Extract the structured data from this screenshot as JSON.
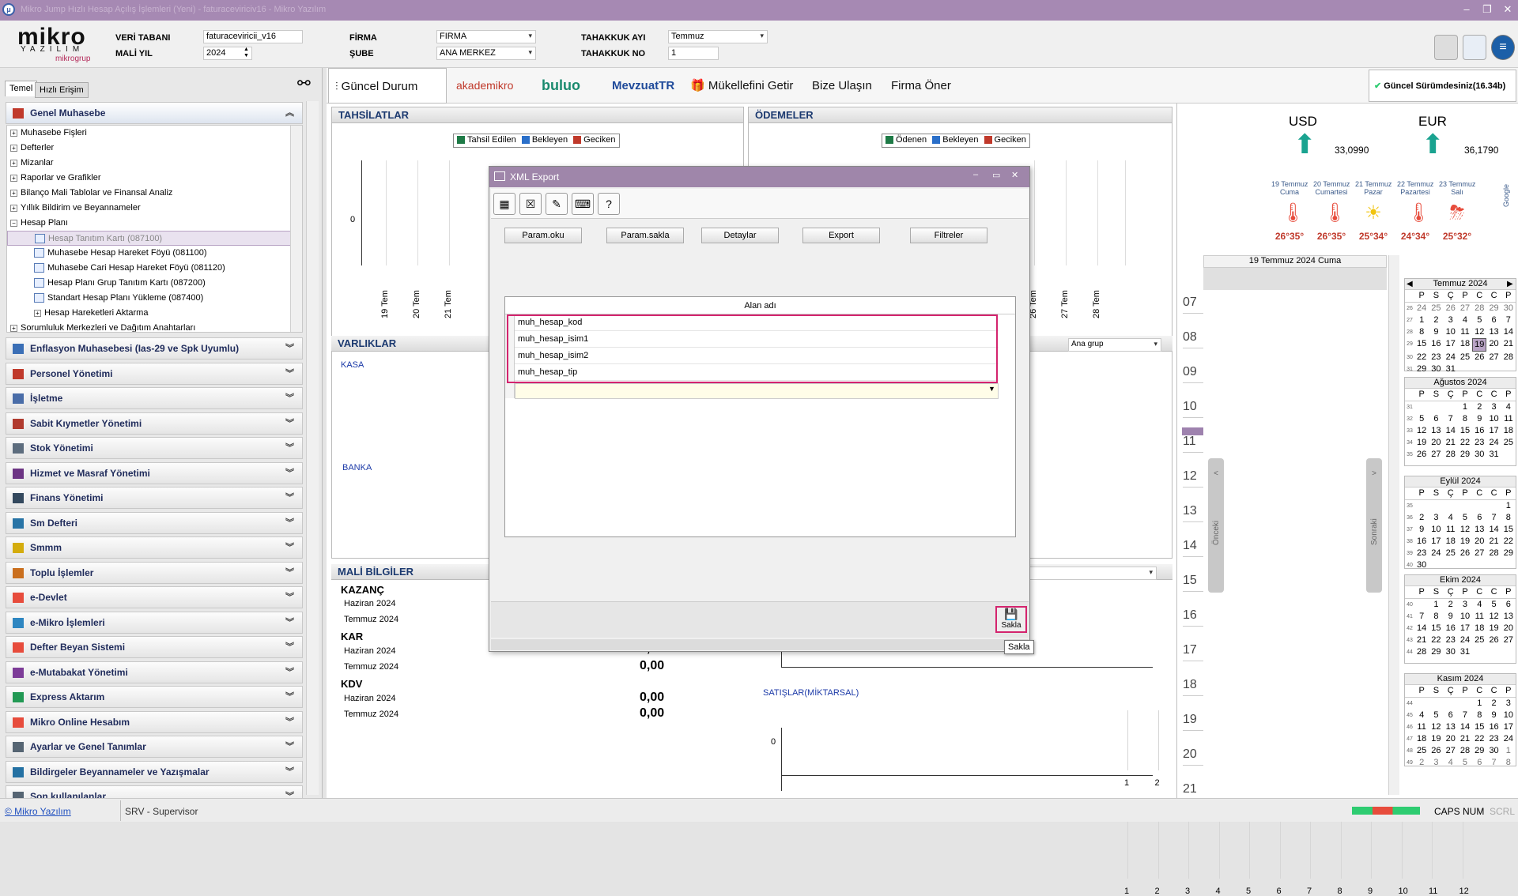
{
  "window": {
    "title": "Mikro Jump Hızlı Hesap Açılış İşlemleri (Yeni) - faturaceviriciv16 - Mikro Yazılım"
  },
  "brand": {
    "name": "mikro",
    "sub": "YAZILIM",
    "group": "mikrogrup"
  },
  "header": {
    "db_label": "VERİ TABANI",
    "db_value": "faturaceviricii_v16",
    "year_label": "MALİ YIL",
    "year_value": "2024",
    "firm_label": "FİRMA",
    "firm_value": "FIRMA",
    "branch_label": "ŞUBE",
    "branch_value": "ANA MERKEZ",
    "accrual_month_label": "TAHAKKUK AYI",
    "accrual_month_value": "Temmuz",
    "accrual_no_label": "TAHAKKUK NO",
    "accrual_no_value": "1"
  },
  "leftpanel": {
    "tabs": [
      "Temel",
      "Hızlı Erişim"
    ],
    "active_section": "Genel Muhasebe",
    "tree": [
      {
        "label": "Muhasebe Fişleri",
        "level": 0,
        "type": "plus"
      },
      {
        "label": "Defterler",
        "level": 0,
        "type": "plus"
      },
      {
        "label": "Mizanlar",
        "level": 0,
        "type": "plus"
      },
      {
        "label": "Raporlar ve Grafikler",
        "level": 0,
        "type": "plus"
      },
      {
        "label": "Bilanço Mali Tablolar ve Finansal Analiz",
        "level": 0,
        "type": "plus"
      },
      {
        "label": "Yıllık Bildirim ve Beyannameler",
        "level": 0,
        "type": "plus"
      },
      {
        "label": "Hesap Planı",
        "level": 0,
        "type": "minus"
      },
      {
        "label": "Hesap Tanıtım Kartı (087100)",
        "level": 1,
        "type": "doc",
        "selected": true
      },
      {
        "label": "Muhasebe Hesap Hareket Föyü (081100)",
        "level": 1,
        "type": "doc"
      },
      {
        "label": "Muhasebe Cari Hesap Hareket Föyü (081120)",
        "level": 1,
        "type": "doc"
      },
      {
        "label": "Hesap Planı Grup Tanıtım Kartı (087200)",
        "level": 1,
        "type": "doc"
      },
      {
        "label": "Standart Hesap Planı Yükleme (087400)",
        "level": 1,
        "type": "doc"
      },
      {
        "label": "Hesap Hareketleri Aktarma",
        "level": 1,
        "type": "plus"
      },
      {
        "label": "Sorumluluk Merkezleri ve Dağıtım Anahtarları",
        "level": 0,
        "type": "plus"
      }
    ],
    "sections": [
      {
        "label": "Enflasyon Muhasebesi (Ias-29 ve Spk Uyumlu)",
        "color": "#3b6fb6"
      },
      {
        "label": "Personel Yönetimi",
        "color": "#c0392b"
      },
      {
        "label": "İşletme",
        "color": "#4a6da8"
      },
      {
        "label": "Sabit Kıymetler Yönetimi",
        "color": "#b03a2e"
      },
      {
        "label": "Stok Yönetimi",
        "color": "#5d6d7e"
      },
      {
        "label": "Hizmet ve Masraf Yönetimi",
        "color": "#6c3483"
      },
      {
        "label": "Finans Yönetimi",
        "color": "#34495e"
      },
      {
        "label": "Sm Defteri",
        "color": "#2874a6"
      },
      {
        "label": "Smmm",
        "color": "#d4ac0d"
      },
      {
        "label": "Toplu İşlemler",
        "color": "#ca6f1e"
      },
      {
        "label": "e-Devlet",
        "color": "#e74c3c"
      },
      {
        "label": "e-Mikro İşlemleri",
        "color": "#2e86c1"
      },
      {
        "label": "Defter Beyan Sistemi",
        "color": "#e74c3c"
      },
      {
        "label": "e-Mutabakat Yönetimi",
        "color": "#7d3c98"
      },
      {
        "label": "Express Aktarım",
        "color": "#229954"
      },
      {
        "label": "Mikro Online Hesabım",
        "color": "#e74c3c"
      },
      {
        "label": "Ayarlar ve Genel Tanımlar",
        "color": "#566573"
      },
      {
        "label": "Bildirgeler Beyannameler ve Yazışmalar",
        "color": "#2471a3"
      },
      {
        "label": "Son kullanılanlar",
        "color": "#566573"
      }
    ]
  },
  "toolbar": {
    "items": [
      "Güncel Durum",
      "akademikro",
      "buluo",
      "MevzuatTR",
      "Mükellefini Getir",
      "Bize Ulaşın",
      "Firma Öner"
    ],
    "version_text": "Güncel Sürümdesiniz(16.34b)"
  },
  "dashboard": {
    "collections_title": "TAHSİLATLAR",
    "collections_legend": [
      "Tahsil Edilen",
      "Bekleyen",
      "Geciken"
    ],
    "payments_title": "ÖDEMELER",
    "payments_legend": [
      "Ödenen",
      "Bekleyen",
      "Geciken"
    ],
    "zero": "0",
    "date_labels_left": [
      "19 Tem",
      "20 Tem",
      "21 Tem"
    ],
    "date_labels_right": [
      "26 Tem",
      "27 Tem",
      "28 Tem"
    ],
    "assets_title": "VARLIKLAR",
    "kasa": "KASA",
    "banka": "BANKA",
    "group_select": "Ana grup",
    "financial_title": "MALİ BİLGİLER",
    "profit_label": "KAZANÇ",
    "income_label": "KAR",
    "kdv_label": "KDV",
    "month1": "Haziran 2024",
    "month2": "Temmuz 2024",
    "val_partial": "0,00",
    "kdv_jun": "0,00",
    "kdv_jul": "0,00",
    "sales_qty_label": "SATIŞLAR(MİKTARSAL)",
    "months_axis": [
      "1",
      "2",
      "3",
      "4",
      "5",
      "6",
      "7",
      "8",
      "9",
      "10",
      "11",
      "12"
    ]
  },
  "currency": {
    "usd_label": "USD",
    "usd_value": "33,0990",
    "eur_label": "EUR",
    "eur_value": "36,1790"
  },
  "weather": [
    {
      "day": "19 Temmuz",
      "dow": "Cuma",
      "temp": "26°35°",
      "icon": "thermometer"
    },
    {
      "day": "20 Temmuz",
      "dow": "Cumartesi",
      "temp": "26°35°",
      "icon": "thermometer"
    },
    {
      "day": "21 Temmuz",
      "dow": "Pazar",
      "temp": "25°34°",
      "icon": "sun-cloud"
    },
    {
      "day": "22 Temmuz",
      "dow": "Pazartesi",
      "temp": "24°34°",
      "icon": "thermometer"
    },
    {
      "day": "23 Temmuz",
      "dow": "Salı",
      "temp": "25°32°",
      "icon": "storm"
    }
  ],
  "weather_brand": "Google",
  "agenda": {
    "date_label": "19 Temmuz 2024 Cuma",
    "hours": [
      "07",
      "08",
      "09",
      "10",
      "11",
      "12",
      "13",
      "14",
      "15",
      "16",
      "17",
      "18",
      "19",
      "20",
      "21"
    ],
    "prev_label": "Önceki",
    "next_label": "Sonraki"
  },
  "calendars": [
    {
      "month": "Temmuz 2024",
      "weeks": [
        [
          "26",
          "24",
          "25",
          "26",
          "27",
          "28",
          "29",
          "30"
        ],
        [
          "27",
          "1",
          "2",
          "3",
          "4",
          "5",
          "6",
          "7"
        ],
        [
          "28",
          "8",
          "9",
          "10",
          "11",
          "12",
          "13",
          "14"
        ],
        [
          "29",
          "15",
          "16",
          "17",
          "18",
          "19",
          "20",
          "21"
        ],
        [
          "30",
          "22",
          "23",
          "24",
          "25",
          "26",
          "27",
          "28"
        ],
        [
          "31",
          "29",
          "30",
          "31",
          "",
          "",
          "",
          ""
        ]
      ]
    },
    {
      "month": "Ağustos 2024",
      "weeks": [
        [
          "31",
          "",
          "",
          "",
          "1",
          "2",
          "3",
          "4"
        ],
        [
          "32",
          "5",
          "6",
          "7",
          "8",
          "9",
          "10",
          "11"
        ],
        [
          "33",
          "12",
          "13",
          "14",
          "15",
          "16",
          "17",
          "18"
        ],
        [
          "34",
          "19",
          "20",
          "21",
          "22",
          "23",
          "24",
          "25"
        ],
        [
          "35",
          "26",
          "27",
          "28",
          "29",
          "30",
          "31",
          ""
        ]
      ]
    },
    {
      "month": "Eylül 2024",
      "weeks": [
        [
          "35",
          "",
          "",
          "",
          "",
          "",
          "",
          "1"
        ],
        [
          "36",
          "2",
          "3",
          "4",
          "5",
          "6",
          "7",
          "8"
        ],
        [
          "37",
          "9",
          "10",
          "11",
          "12",
          "13",
          "14",
          "15"
        ],
        [
          "38",
          "16",
          "17",
          "18",
          "19",
          "20",
          "21",
          "22"
        ],
        [
          "39",
          "23",
          "24",
          "25",
          "26",
          "27",
          "28",
          "29"
        ],
        [
          "40",
          "30",
          "",
          "",
          "",
          "",
          "",
          ""
        ]
      ]
    },
    {
      "month": "Ekim 2024",
      "weeks": [
        [
          "40",
          "",
          "1",
          "2",
          "3",
          "4",
          "5",
          "6"
        ],
        [
          "41",
          "7",
          "8",
          "9",
          "10",
          "11",
          "12",
          "13"
        ],
        [
          "42",
          "14",
          "15",
          "16",
          "17",
          "18",
          "19",
          "20"
        ],
        [
          "43",
          "21",
          "22",
          "23",
          "24",
          "25",
          "26",
          "27"
        ],
        [
          "44",
          "28",
          "29",
          "30",
          "31",
          "",
          "",
          ""
        ]
      ]
    },
    {
      "month": "Kasım 2024",
      "weeks": [
        [
          "44",
          "",
          "",
          "",
          "",
          "1",
          "2",
          "3"
        ],
        [
          "45",
          "4",
          "5",
          "6",
          "7",
          "8",
          "9",
          "10"
        ],
        [
          "46",
          "11",
          "12",
          "13",
          "14",
          "15",
          "16",
          "17"
        ],
        [
          "47",
          "18",
          "19",
          "20",
          "21",
          "22",
          "23",
          "24"
        ],
        [
          "48",
          "25",
          "26",
          "27",
          "28",
          "29",
          "30",
          "1"
        ],
        [
          "49",
          "2",
          "3",
          "4",
          "5",
          "6",
          "7",
          "8"
        ]
      ]
    }
  ],
  "cal_day_headers": [
    "P",
    "S",
    "Ç",
    "P",
    "C",
    "C",
    "P"
  ],
  "dialog": {
    "title": "XML Export",
    "buttons": [
      "Param.oku",
      "Param.sakla",
      "Detaylar",
      "Export",
      "Filtreler"
    ],
    "column_header": "Alan adı",
    "rows": [
      "muh_hesap_kod",
      "muh_hesap_isim1",
      "muh_hesap_isim2",
      "muh_hesap_tip"
    ],
    "save_label": "Sakla",
    "tooltip": "Sakla"
  },
  "statusbar": {
    "link": "© Mikro Yazılım",
    "user": "SRV - Supervisor",
    "caps": "CAPS",
    "num": "NUM",
    "scrl": "SCRL"
  }
}
